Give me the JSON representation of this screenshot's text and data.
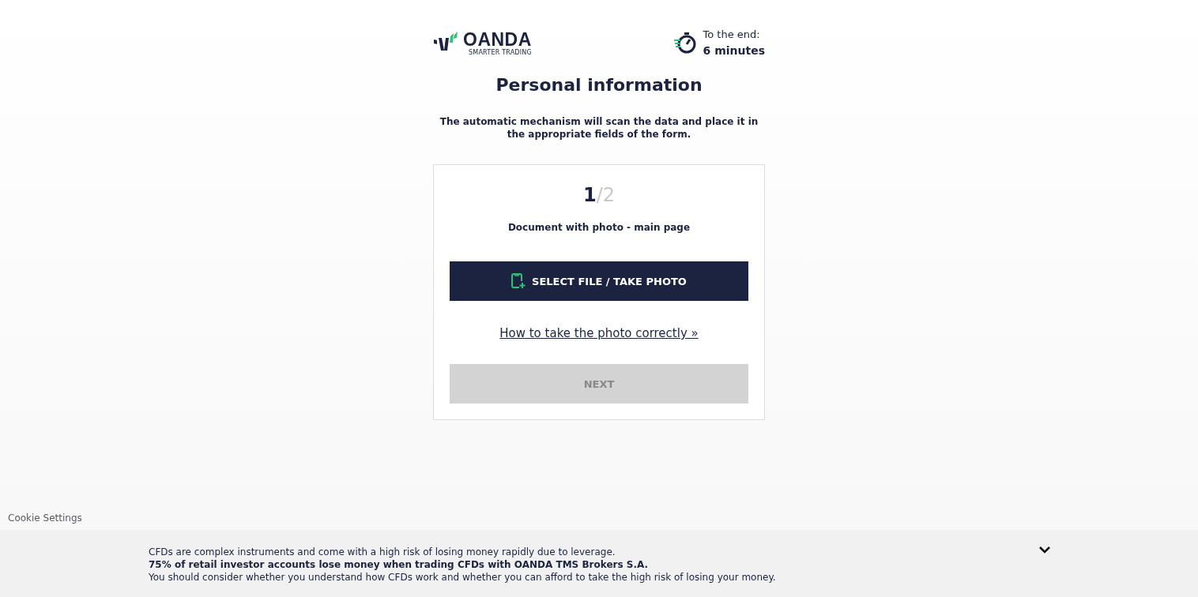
{
  "header": {
    "logo": {
      "name": "OANDA",
      "tagline": "SMARTER TRADING"
    },
    "timer": {
      "label": "To the end:",
      "value": "6 minutes"
    }
  },
  "title": "Personal information",
  "intro": "The automatic mechanism will scan the data and place it in the appropriate fields of the form.",
  "card": {
    "step": {
      "current": "1",
      "total": "/2"
    },
    "document": "Document with photo - main page",
    "select_button": "SELECT FILE / TAKE PHOTO",
    "help_link": "How to take the photo correctly »",
    "next_button": {
      "label": "NEXT",
      "disabled": true
    }
  },
  "cookie_settings": "Cookie Settings",
  "risk_banner": {
    "lines": [
      {
        "text": "CFDs are complex instruments and come with a high risk of losing money rapidly due to leverage.",
        "bold": false
      },
      {
        "text": "75% of retail investor accounts lose money when trading CFDs with OANDA TMS Brokers S.A.",
        "bold": true
      },
      {
        "text": "You should consider whether you understand how CFDs work and whether you can afford to take the high risk of losing your money.",
        "bold": false
      }
    ],
    "expanded": false
  }
}
